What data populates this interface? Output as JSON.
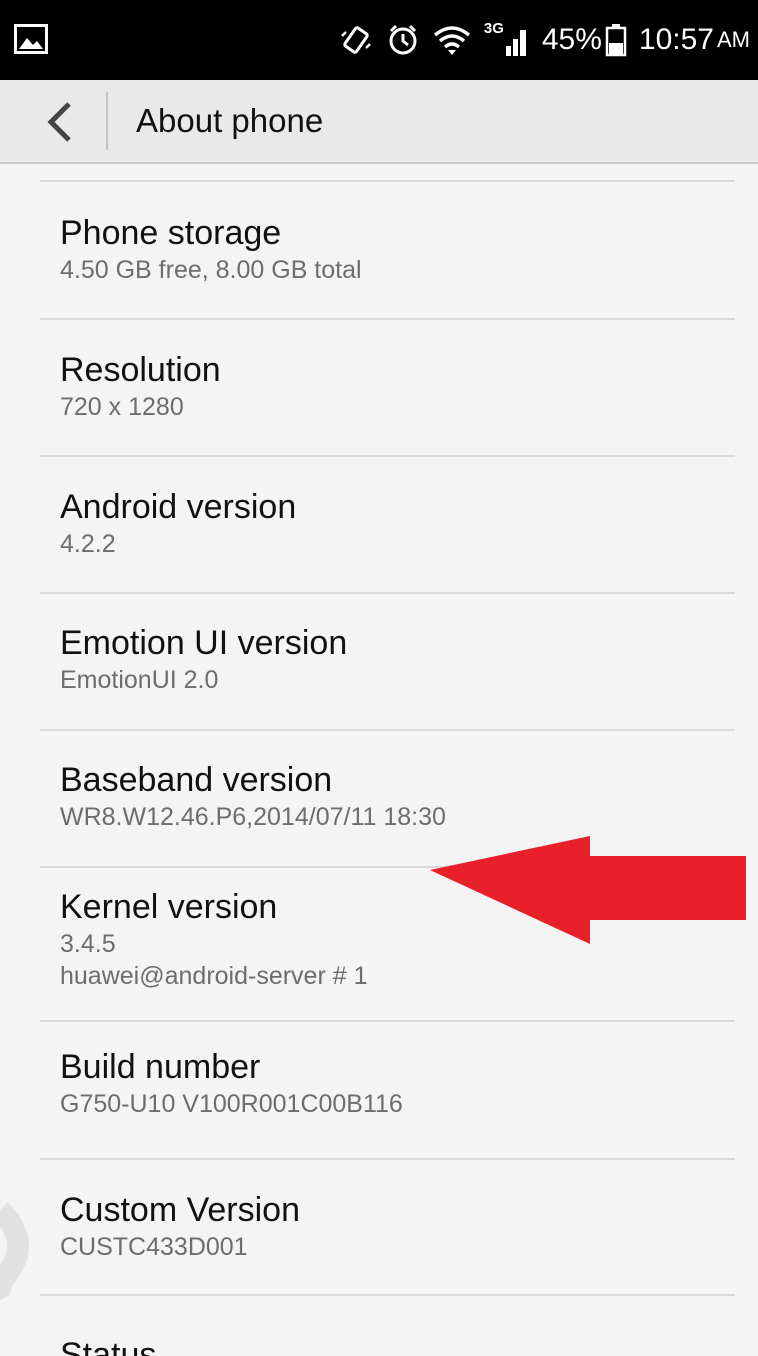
{
  "status_bar": {
    "icons": [
      "image-icon",
      "vibrate-icon",
      "alarm-icon",
      "wifi-icon",
      "network-3g-signal-icon",
      "battery-icon"
    ],
    "network_type": "3G",
    "battery_percent": "45%",
    "battery_level": 0.45,
    "time": "10:57",
    "ampm": "AM"
  },
  "app_bar": {
    "back_icon": "chevron-left-icon",
    "title": "About phone"
  },
  "items": [
    {
      "title": "Phone storage",
      "subtitle": "4.50 GB free, 8.00 GB total"
    },
    {
      "title": "Resolution",
      "subtitle": "720 x 1280"
    },
    {
      "title": "Android version",
      "subtitle": "4.2.2"
    },
    {
      "title": "Emotion UI version",
      "subtitle": "EmotionUI 2.0"
    },
    {
      "title": "Baseband version",
      "subtitle": "WR8.W12.46.P6,2014/07/11 18:30"
    },
    {
      "title": "Kernel version",
      "subtitle": "3.4.5",
      "subtitle2": "huawei@android-server # 1"
    },
    {
      "title": "Build number",
      "subtitle": "G750-U10 V100R001C00B116"
    },
    {
      "title": "Custom Version",
      "subtitle": "CUSTC433D001"
    },
    {
      "title": "Status"
    }
  ],
  "annotation": {
    "arrow_color": "#e8202a",
    "points_to": "Build number"
  }
}
